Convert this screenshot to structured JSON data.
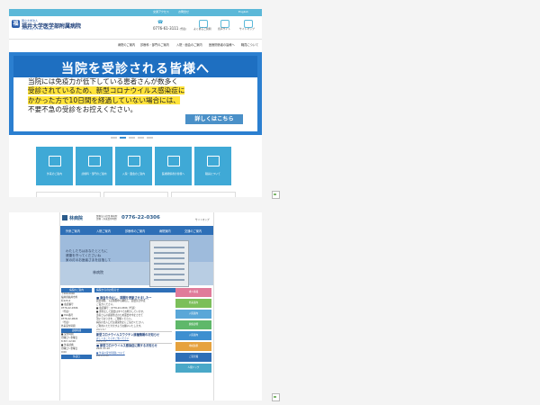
{
  "hospital": {
    "topbar_links": [
      "交通アクセス",
      "お問合せ",
      "English"
    ],
    "logo_mark": "福",
    "logo_small": "国立大学法人",
    "logo_name": "福井大学医学部附属病院",
    "logo_en": "University of Fukui Hospital",
    "phone": "0776-61-3111",
    "phone_note": "(代表)",
    "utility": [
      "よくあるご質問",
      "音声サイト",
      "サイトマップ"
    ],
    "nav": [
      "病院のご案内",
      "診療科・部門のご案内",
      "入院・面会のご案内",
      "医療関係者の皆様へ",
      "職員について"
    ],
    "banner": {
      "title": "当院を受診される皆様へ",
      "line1": "当院には免疫力が低下している患者さんが数多く",
      "line2": "受診されているため、新型コロナウイルス感染症に",
      "line3": "かかった方で10日間を経過していない場合には、",
      "line4": "不要不急の受診をお控えください。",
      "button": "詳しくはこちら"
    },
    "tiles": [
      "外来のご案内",
      "診療科・部門のご案内",
      "入院・面会のご案内",
      "医療関係者の皆様へ",
      "職員について"
    ]
  },
  "clinic": {
    "logo_mark": "",
    "logo": "林病院",
    "addr1": "医療法人社団 林病院",
    "addr2": "診療・外来受付時間",
    "phone": "0776-22-0306",
    "sitemap": "サイトマップ",
    "nav": [
      "外来ご案内",
      "入院ご案内",
      "診療科のご案内",
      "病院案内",
      "交通のご案内"
    ],
    "hero_copy": [
      "わたしたちはあなたとともに",
      "健康を守ってくださいね",
      "家の灯のお医者さまを目指して"
    ],
    "hero_name": "林病院",
    "left": {
      "head1": "病院のご案内",
      "addr": [
        "〒000-0000",
        "福井県福井市外",
        "町123-4",
        "■ 電話番号",
        "0776-22-0306",
        "（代表）",
        "■ FAX番号",
        "0776-22-0824",
        "（代表）",
        "外来受付時間"
      ],
      "head2": "診療時間",
      "hours": [
        "■ 受付時間",
        "月曜日～金曜日",
        "8:30～12:00",
        "■ 外来診療",
        "月曜日～金曜日",
        "9:00"
      ],
      "head3": "休診日"
    },
    "news": {
      "head": "病院からのお知らせ",
      "title1": "■ 面会を中止し、期間を更新させましたー",
      "body1": [
        "面会制限、下記期間中も継続し、面会禁止中は",
        "ご協力ください。",
        "■ 電話番号：0776-22-0306（代表）",
        "",
        "■ 原則として面会はすべてお断りしています。",
        "患者さんの感染防止のため面会を中止させて",
        "頂いております。ご理解ください。",
        "",
        "病院の出入口では感染防止にご協力ください。",
        "ご利用いただけますようお願いいたします。"
      ],
      "date1": "2021.8.7",
      "title2": "新型コロナウイルスワクチン接種情報のお知らせ",
      "link2": "詳しくはこちらをご覧ください",
      "date2": "2021.7.6",
      "title3": "■ 新型コロナウイルス感染症に関するお知らせ",
      "body3": [
        "2021.11.10",
        "■ 外来の受付時間について"
      ],
      "date3": "2021.11.30"
    },
    "right": [
      "求人情報",
      "外来案内",
      "入院案内",
      "健康診断",
      "入院案内",
      "地域連携",
      "ご意見箱",
      "人間ドック"
    ]
  },
  "colors": {
    "accent": "#3fa9d6",
    "banner": "#1e6fc1",
    "highlight": "#ffe33a",
    "clinic_nav": "#2e6fb7"
  }
}
